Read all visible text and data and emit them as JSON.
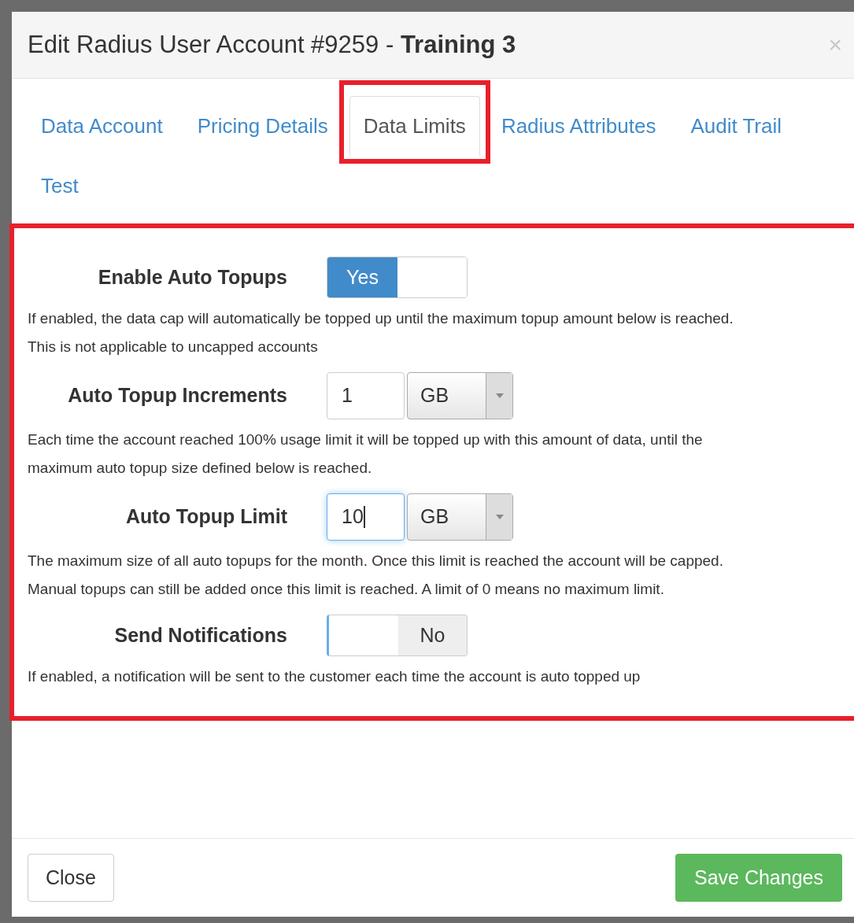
{
  "dialog": {
    "title": "Edit Radius User Account #9259 - **Training 3**",
    "close": "×"
  },
  "tabs": [
    {
      "label": "Data Account",
      "selected": false
    },
    {
      "label": "Pricing Details",
      "selected": false
    },
    {
      "label": "Data Limits",
      "selected": true
    },
    {
      "label": "Radius Attributes",
      "selected": false
    },
    {
      "label": "Audit Trail",
      "selected": false
    },
    {
      "label": "Test",
      "selected": false
    }
  ],
  "settings": [
    {
      "kind": "toggle",
      "label": "Enable Auto Topups",
      "on": true,
      "switch_text": "Yes",
      "help": [
        "If enabled, the data cap will automatically be topped up until the maximum topup amount below is reached.",
        "This is not applicable to uncapped accounts"
      ]
    },
    {
      "kind": "amount",
      "label": "Auto Topup Increments",
      "value": "1",
      "unit": "GB",
      "focused": false,
      "help": [
        "Each time the account reached 100% usage limit it will be topped up with this amount of data, until the",
        "maximum auto topup size defined below is reached."
      ]
    },
    {
      "kind": "amount",
      "label": "Auto Topup Limit",
      "value": "10",
      "unit": "GB",
      "focused": true,
      "help": [
        "The maximum size of all auto topups for the month. Once this limit is reached the account will be capped.",
        "Manual topups can still be added once this limit is reached. A limit of 0 means no maximum limit."
      ]
    },
    {
      "kind": "toggle",
      "label": "Send Notifications",
      "on": false,
      "switch_text": "No",
      "help": [
        "If enabled, a notification will be sent to the customer each time the account is auto topped up"
      ]
    }
  ],
  "footer": {
    "close_button": "Close",
    "save_button": "Save Changes"
  }
}
